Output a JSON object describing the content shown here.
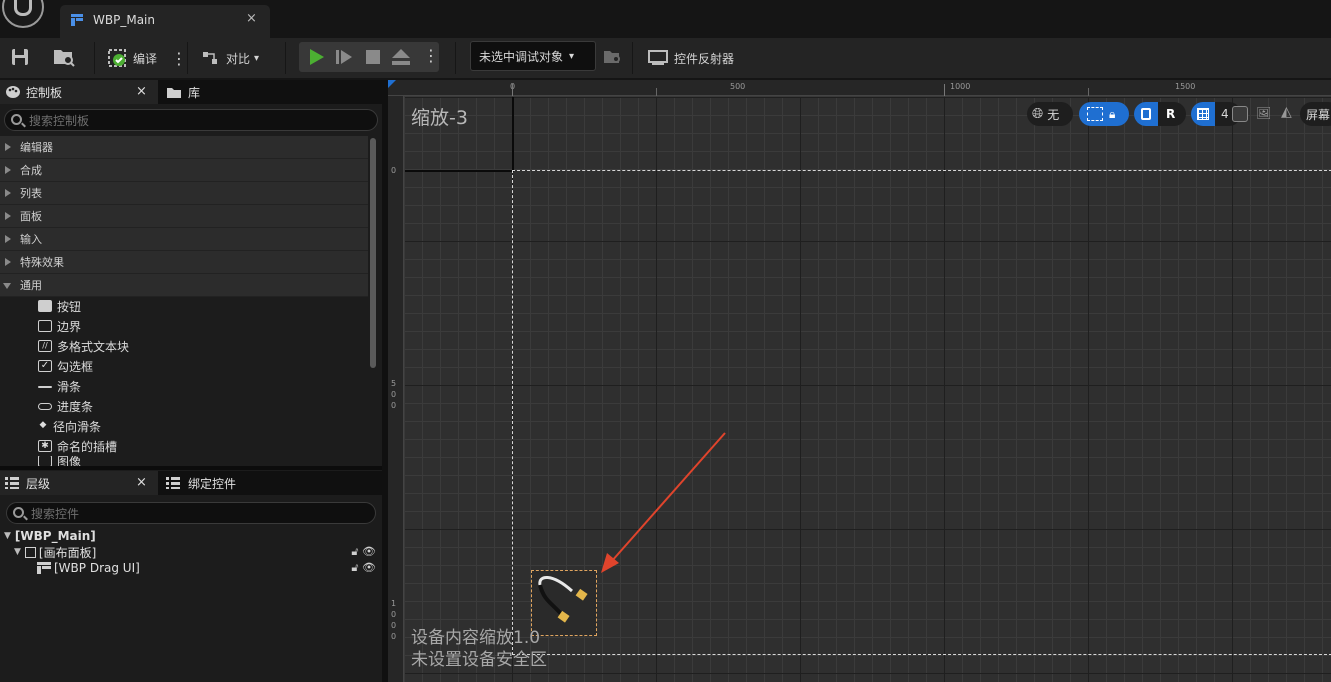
{
  "tab": {
    "title": "WBP_Main",
    "close": "×"
  },
  "toolbar": {
    "compile": "编译",
    "diff": "对比",
    "debug_target": "未选中调试对象",
    "widget_reflector": "控件反射器"
  },
  "palette": {
    "tab_label": "控制板",
    "tab_close": "×",
    "library_tab": "库",
    "search_placeholder": "搜索控制板",
    "categories": [
      "编辑器",
      "合成",
      "列表",
      "面板",
      "输入",
      "特殊效果",
      "通用"
    ],
    "common_items": [
      "按钮",
      "边界",
      "多格式文本块",
      "勾选框",
      "滑条",
      "进度条",
      "径向滑条",
      "命名的插槽",
      "图像"
    ]
  },
  "hierarchy": {
    "tab_label": "层级",
    "tab_close": "×",
    "bind_tab": "绑定控件",
    "search_placeholder": "搜索控件",
    "root": "[WBP_Main]",
    "canvas": "[画布面板]",
    "child": "[WBP Drag UI]"
  },
  "viewport": {
    "zoom_label": "缩放-3",
    "ruler_top": [
      "0",
      "500",
      "1000",
      "1500"
    ],
    "ruler_left": [
      "0",
      "5\n0\n0",
      "1\n0\n0\n0"
    ],
    "btn_none": "无",
    "btn_r": "R",
    "btn_grid_num": "4",
    "btn_screen": "屏幕",
    "device_scale": "设备内容缩放1.0",
    "safe_zone": "未设置设备安全区"
  },
  "colors": {
    "accent": "#1f6fd1",
    "play": "#4caf32",
    "arrow": "#e0442c"
  }
}
